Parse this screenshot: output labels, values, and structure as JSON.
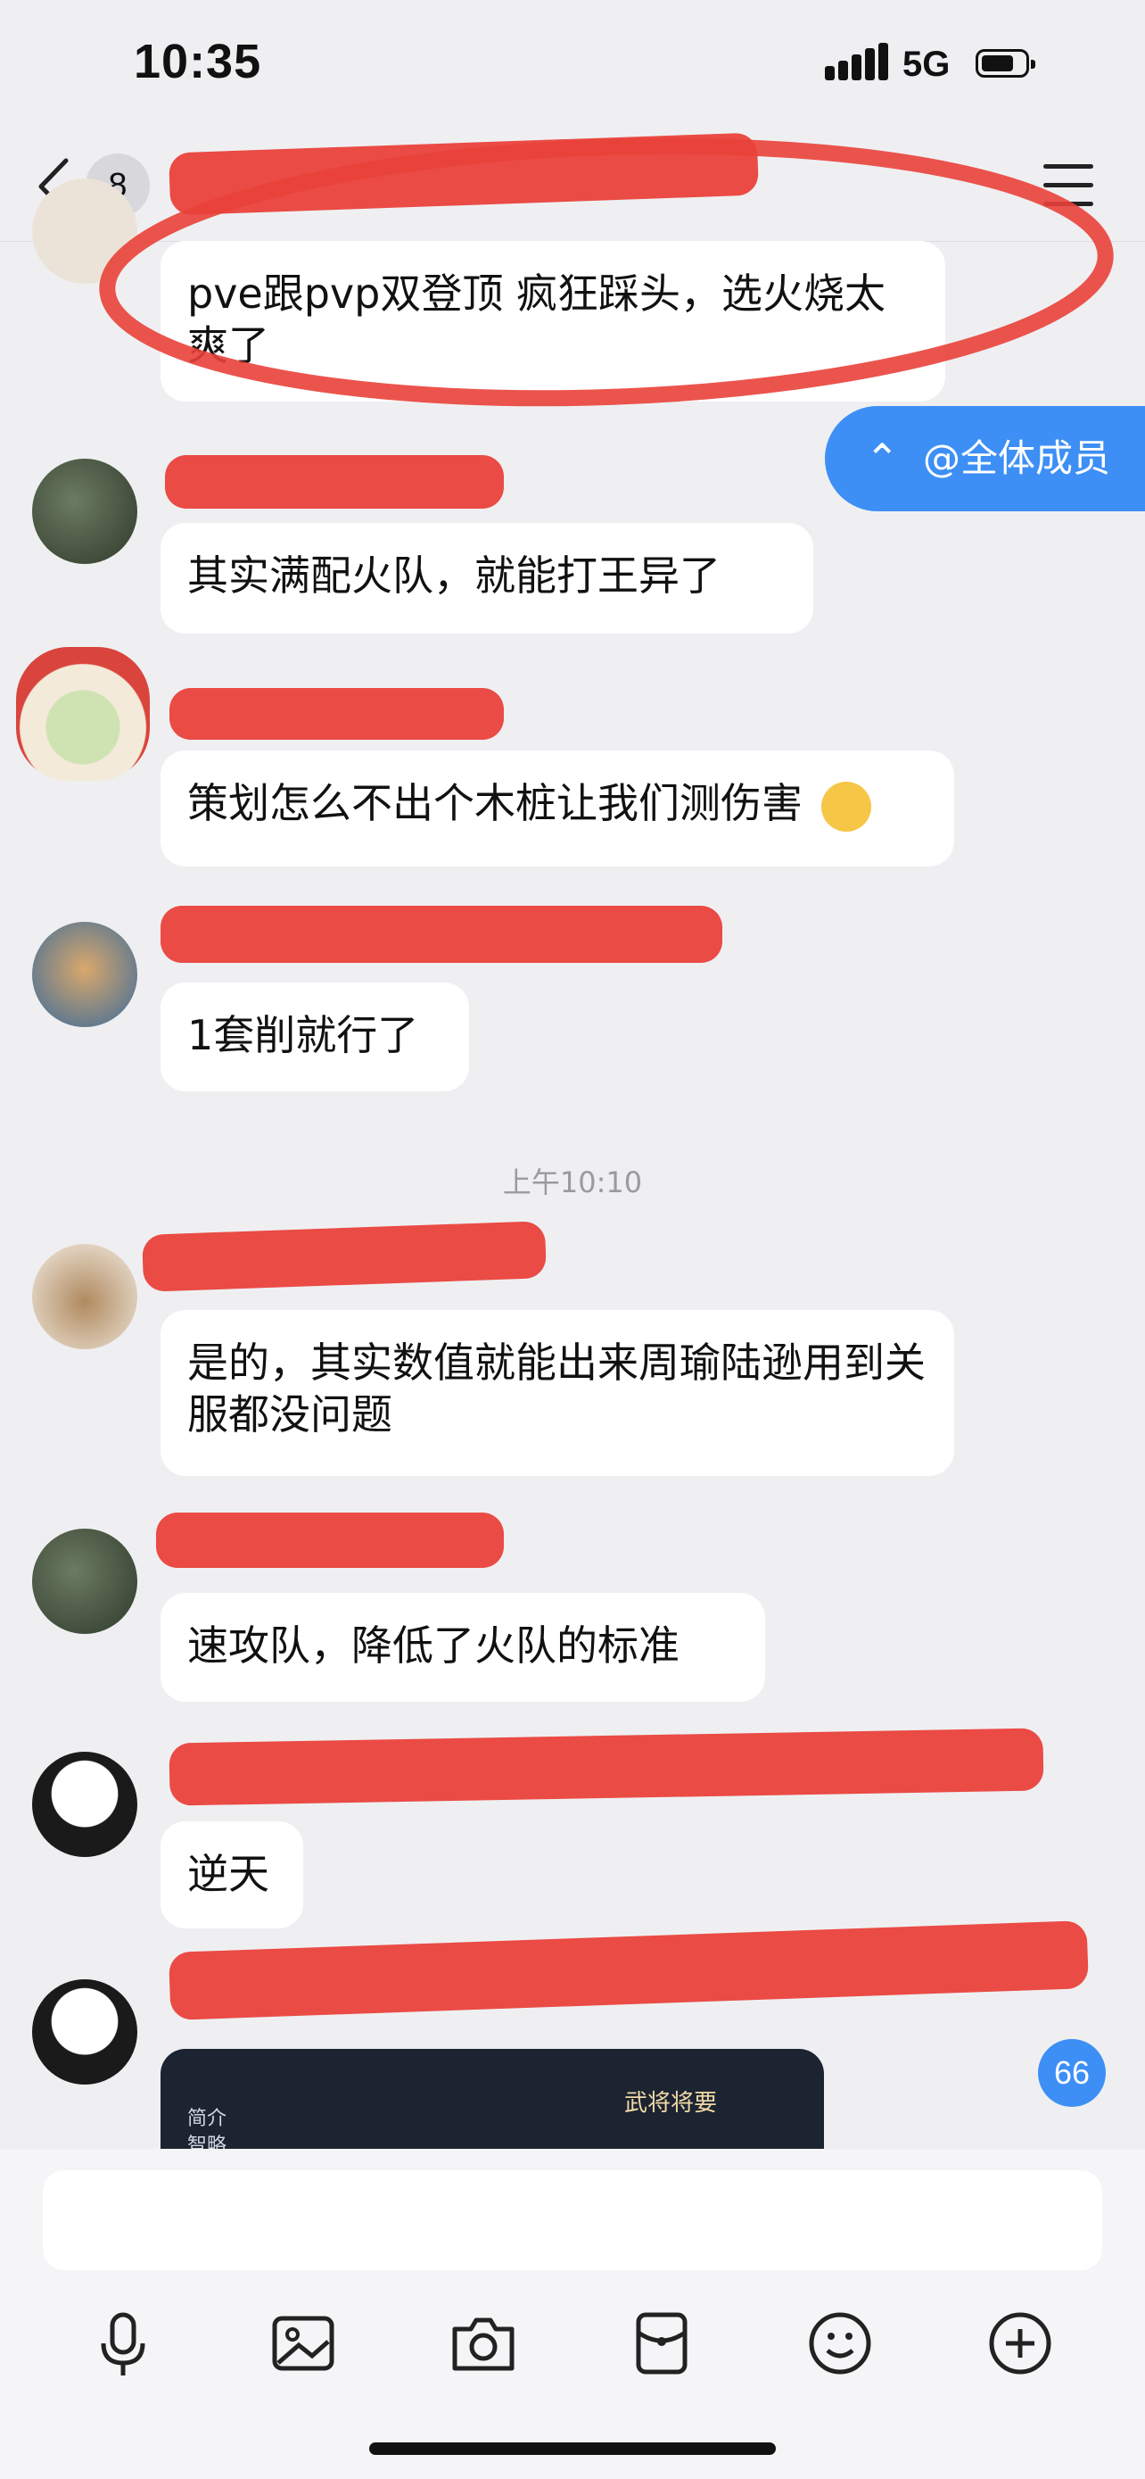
{
  "status_bar": {
    "time": "10:35",
    "network": "5G",
    "battery_level": 0.72
  },
  "nav": {
    "back_count": "8",
    "title": ""
  },
  "floating": {
    "all_members_label": "@全体成员",
    "unread_count": "66"
  },
  "messages": [
    {
      "text": "pve跟pvp双登顶 疯狂踩头，选火烧太爽了"
    },
    {
      "text": "其实满配火队，就能打王异了"
    },
    {
      "text": "策划怎么不出个木桩让我们测伤害"
    },
    {
      "text": "1套削就行了"
    },
    {
      "text": "是的，其实数值就能出来周瑜陆逊用到关服都没问题"
    },
    {
      "text": "速攻队，降低了火队的标准"
    },
    {
      "text": "逆天"
    }
  ],
  "timestamp": "上午10:10",
  "image_preview": {
    "left_tabs": [
      "简介",
      "智略"
    ],
    "right_title": "武将将要"
  },
  "toolbar": {
    "icons": [
      "microphone-icon",
      "image-icon",
      "camera-icon",
      "red-packet-icon",
      "emoji-icon",
      "plus-icon"
    ]
  },
  "colors": {
    "accent": "#3d8ff5",
    "redaction": "#e9413a",
    "background": "#efeff2"
  }
}
